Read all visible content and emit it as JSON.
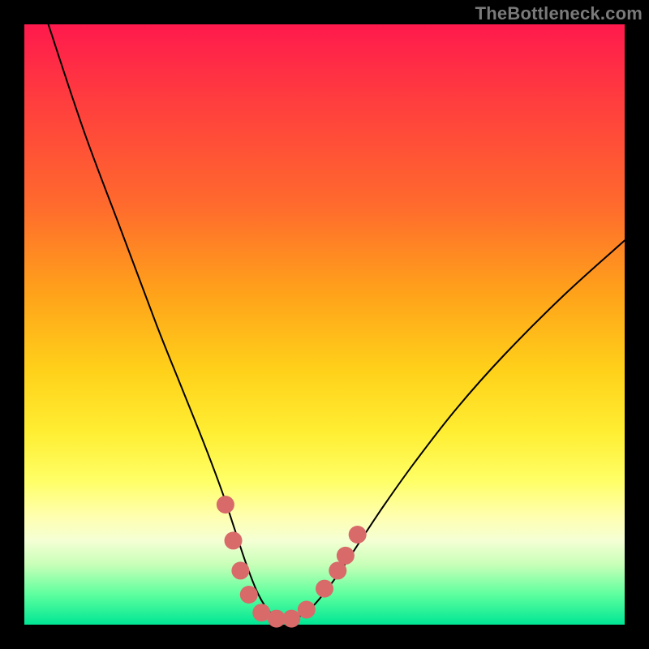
{
  "watermark": "TheBottleneck.com",
  "chart_data": {
    "type": "line",
    "title": "",
    "xlabel": "",
    "ylabel": "",
    "xlim": [
      0,
      100
    ],
    "ylim": [
      0,
      100
    ],
    "series": [
      {
        "name": "bottleneck-curve",
        "x": [
          4,
          10,
          16,
          22,
          26,
          30,
          33,
          35,
          37,
          39,
          41,
          43,
          45,
          48,
          52,
          56,
          60,
          65,
          72,
          80,
          90,
          100
        ],
        "values": [
          100,
          82,
          66,
          50,
          40,
          30,
          22,
          16,
          10,
          5,
          2,
          1,
          1,
          3,
          8,
          14,
          20,
          27,
          36,
          45,
          55,
          64
        ]
      }
    ],
    "markers": {
      "name": "highlight-dots",
      "color": "#d86a6a",
      "points": [
        {
          "x": 33.5,
          "y": 20
        },
        {
          "x": 34.8,
          "y": 14
        },
        {
          "x": 36.0,
          "y": 9
        },
        {
          "x": 37.4,
          "y": 5
        },
        {
          "x": 39.5,
          "y": 2
        },
        {
          "x": 42.0,
          "y": 1
        },
        {
          "x": 44.5,
          "y": 1
        },
        {
          "x": 47.0,
          "y": 2.5
        },
        {
          "x": 50.0,
          "y": 6
        },
        {
          "x": 52.2,
          "y": 9
        },
        {
          "x": 53.5,
          "y": 11.5
        },
        {
          "x": 55.5,
          "y": 15
        }
      ]
    },
    "background_gradient": {
      "top": "#ff1a4d",
      "mid_upper": "#ffa31a",
      "mid": "#ffee33",
      "mid_lower": "#ffffb0",
      "bottom": "#00e694"
    }
  }
}
